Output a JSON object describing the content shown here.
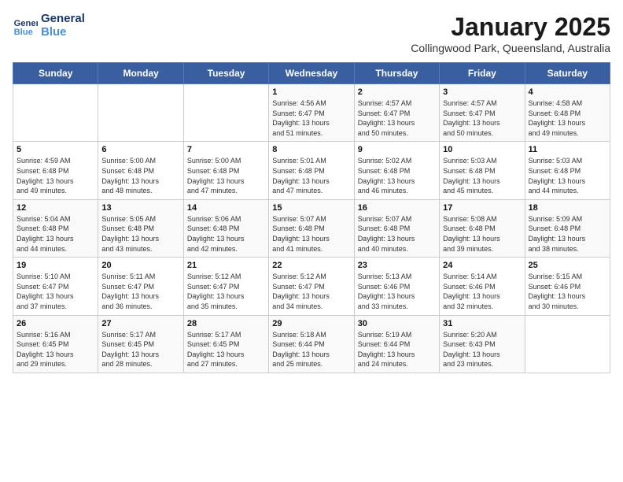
{
  "header": {
    "logo_line1": "General",
    "logo_line2": "Blue",
    "month": "January 2025",
    "location": "Collingwood Park, Queensland, Australia"
  },
  "weekdays": [
    "Sunday",
    "Monday",
    "Tuesday",
    "Wednesday",
    "Thursday",
    "Friday",
    "Saturday"
  ],
  "weeks": [
    [
      {
        "day": "",
        "info": ""
      },
      {
        "day": "",
        "info": ""
      },
      {
        "day": "",
        "info": ""
      },
      {
        "day": "1",
        "info": "Sunrise: 4:56 AM\nSunset: 6:47 PM\nDaylight: 13 hours\nand 51 minutes."
      },
      {
        "day": "2",
        "info": "Sunrise: 4:57 AM\nSunset: 6:47 PM\nDaylight: 13 hours\nand 50 minutes."
      },
      {
        "day": "3",
        "info": "Sunrise: 4:57 AM\nSunset: 6:47 PM\nDaylight: 13 hours\nand 50 minutes."
      },
      {
        "day": "4",
        "info": "Sunrise: 4:58 AM\nSunset: 6:48 PM\nDaylight: 13 hours\nand 49 minutes."
      }
    ],
    [
      {
        "day": "5",
        "info": "Sunrise: 4:59 AM\nSunset: 6:48 PM\nDaylight: 13 hours\nand 49 minutes."
      },
      {
        "day": "6",
        "info": "Sunrise: 5:00 AM\nSunset: 6:48 PM\nDaylight: 13 hours\nand 48 minutes."
      },
      {
        "day": "7",
        "info": "Sunrise: 5:00 AM\nSunset: 6:48 PM\nDaylight: 13 hours\nand 47 minutes."
      },
      {
        "day": "8",
        "info": "Sunrise: 5:01 AM\nSunset: 6:48 PM\nDaylight: 13 hours\nand 47 minutes."
      },
      {
        "day": "9",
        "info": "Sunrise: 5:02 AM\nSunset: 6:48 PM\nDaylight: 13 hours\nand 46 minutes."
      },
      {
        "day": "10",
        "info": "Sunrise: 5:03 AM\nSunset: 6:48 PM\nDaylight: 13 hours\nand 45 minutes."
      },
      {
        "day": "11",
        "info": "Sunrise: 5:03 AM\nSunset: 6:48 PM\nDaylight: 13 hours\nand 44 minutes."
      }
    ],
    [
      {
        "day": "12",
        "info": "Sunrise: 5:04 AM\nSunset: 6:48 PM\nDaylight: 13 hours\nand 44 minutes."
      },
      {
        "day": "13",
        "info": "Sunrise: 5:05 AM\nSunset: 6:48 PM\nDaylight: 13 hours\nand 43 minutes."
      },
      {
        "day": "14",
        "info": "Sunrise: 5:06 AM\nSunset: 6:48 PM\nDaylight: 13 hours\nand 42 minutes."
      },
      {
        "day": "15",
        "info": "Sunrise: 5:07 AM\nSunset: 6:48 PM\nDaylight: 13 hours\nand 41 minutes."
      },
      {
        "day": "16",
        "info": "Sunrise: 5:07 AM\nSunset: 6:48 PM\nDaylight: 13 hours\nand 40 minutes."
      },
      {
        "day": "17",
        "info": "Sunrise: 5:08 AM\nSunset: 6:48 PM\nDaylight: 13 hours\nand 39 minutes."
      },
      {
        "day": "18",
        "info": "Sunrise: 5:09 AM\nSunset: 6:48 PM\nDaylight: 13 hours\nand 38 minutes."
      }
    ],
    [
      {
        "day": "19",
        "info": "Sunrise: 5:10 AM\nSunset: 6:47 PM\nDaylight: 13 hours\nand 37 minutes."
      },
      {
        "day": "20",
        "info": "Sunrise: 5:11 AM\nSunset: 6:47 PM\nDaylight: 13 hours\nand 36 minutes."
      },
      {
        "day": "21",
        "info": "Sunrise: 5:12 AM\nSunset: 6:47 PM\nDaylight: 13 hours\nand 35 minutes."
      },
      {
        "day": "22",
        "info": "Sunrise: 5:12 AM\nSunset: 6:47 PM\nDaylight: 13 hours\nand 34 minutes."
      },
      {
        "day": "23",
        "info": "Sunrise: 5:13 AM\nSunset: 6:46 PM\nDaylight: 13 hours\nand 33 minutes."
      },
      {
        "day": "24",
        "info": "Sunrise: 5:14 AM\nSunset: 6:46 PM\nDaylight: 13 hours\nand 32 minutes."
      },
      {
        "day": "25",
        "info": "Sunrise: 5:15 AM\nSunset: 6:46 PM\nDaylight: 13 hours\nand 30 minutes."
      }
    ],
    [
      {
        "day": "26",
        "info": "Sunrise: 5:16 AM\nSunset: 6:45 PM\nDaylight: 13 hours\nand 29 minutes."
      },
      {
        "day": "27",
        "info": "Sunrise: 5:17 AM\nSunset: 6:45 PM\nDaylight: 13 hours\nand 28 minutes."
      },
      {
        "day": "28",
        "info": "Sunrise: 5:17 AM\nSunset: 6:45 PM\nDaylight: 13 hours\nand 27 minutes."
      },
      {
        "day": "29",
        "info": "Sunrise: 5:18 AM\nSunset: 6:44 PM\nDaylight: 13 hours\nand 25 minutes."
      },
      {
        "day": "30",
        "info": "Sunrise: 5:19 AM\nSunset: 6:44 PM\nDaylight: 13 hours\nand 24 minutes."
      },
      {
        "day": "31",
        "info": "Sunrise: 5:20 AM\nSunset: 6:43 PM\nDaylight: 13 hours\nand 23 minutes."
      },
      {
        "day": "",
        "info": ""
      }
    ]
  ]
}
